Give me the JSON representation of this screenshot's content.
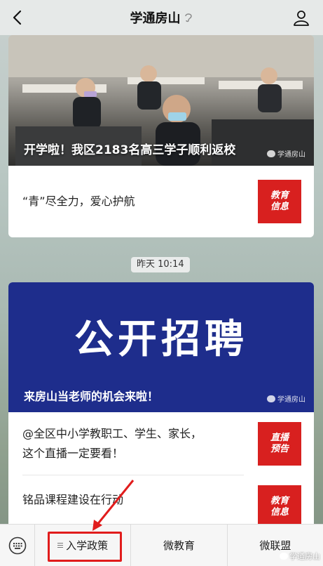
{
  "header": {
    "title": "学通房山"
  },
  "card1": {
    "hero_caption": "开学啦！我区2183名高三学子顺利返校",
    "watermark": "学通房山",
    "sub_title": "“青”尽全力，爱心护航",
    "thumb_line1": "教育",
    "thumb_line2": "信息"
  },
  "timestamp": "昨天 10:14",
  "card2": {
    "hero_big": "公开招聘",
    "hero_caption": "来房山当老师的机会来啦！",
    "watermark": "学通房山",
    "item1_line1": "@全区中小学教职工、学生、家长，",
    "item1_line2": "这个直播一定要看！",
    "item1_thumb_line1": "直播",
    "item1_thumb_line2": "预告",
    "item2": "铭品课程建设在行动",
    "item2_thumb_line1": "教育",
    "item2_thumb_line2": "信息"
  },
  "menu": {
    "items": [
      "入学政策",
      "微教育",
      "微联盟"
    ]
  },
  "corner_mark": "学通房山",
  "colors": {
    "accent_red": "#d8201f",
    "banner_blue": "#1e2d8c",
    "highlight": "#e11c1c"
  }
}
